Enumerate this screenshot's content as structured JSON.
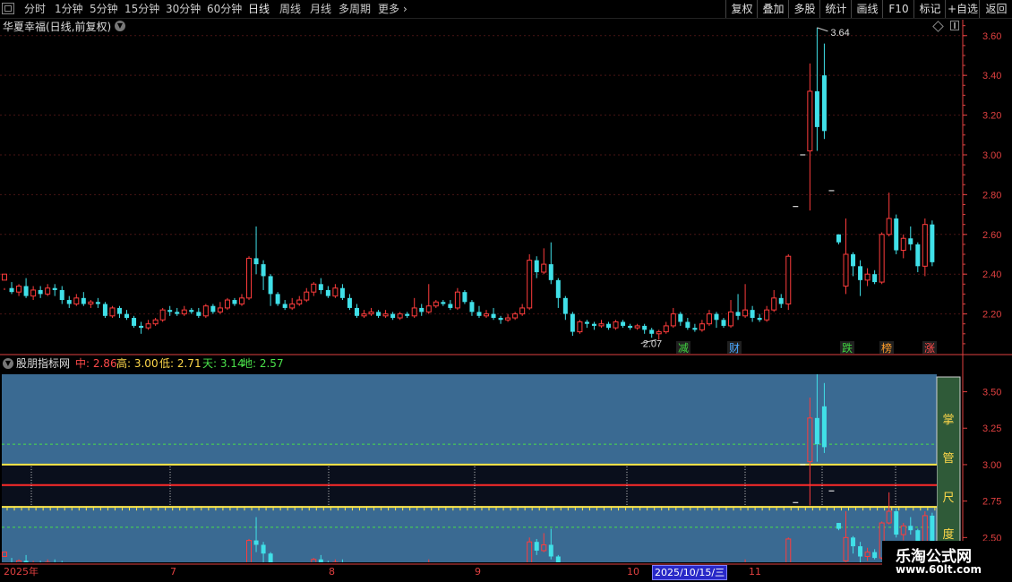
{
  "toolbar": {
    "periods": [
      "分时",
      "1分钟",
      "5分钟",
      "15分钟",
      "30分钟",
      "60分钟",
      "日线",
      "周线",
      "月线",
      "多周期",
      "更多"
    ],
    "active_period": "日线",
    "right_buttons": [
      "复权",
      "叠加",
      "多股",
      "统计",
      "画线",
      "F10",
      "标记",
      "+自选",
      "返回"
    ]
  },
  "main_chart": {
    "title": "华夏幸福(日线,前复权)",
    "high_label": "3.64",
    "low_label": "2.07",
    "axis_labels": [
      "3.60",
      "3.40",
      "3.20",
      "3.00",
      "2.80",
      "2.60",
      "2.40",
      "2.20"
    ],
    "badges": [
      {
        "text": "减",
        "color": "#3fd23f"
      },
      {
        "text": "财",
        "color": "#4aa8ff"
      },
      {
        "text": "跌",
        "color": "#3fd23f"
      },
      {
        "text": "榜",
        "color": "#ff9d2a"
      },
      {
        "text": "涨",
        "color": "#ff4a4a"
      }
    ]
  },
  "indicator": {
    "name": "股朋指标网",
    "values": [
      {
        "label": "中: 2.86",
        "color": "#ff4a4a"
      },
      {
        "label": "高: 3.00",
        "color": "#ffd84a"
      },
      {
        "label": "低: 2.71",
        "color": "#ffd84a"
      },
      {
        "label": "天: 3.14",
        "color": "#4ae04a"
      },
      {
        "label": "地: 2.57",
        "color": "#4ae04a"
      }
    ],
    "axis_labels": [
      "3.50",
      "3.25",
      "3.00",
      "2.75",
      "2.50"
    ],
    "side_labels": [
      "掌",
      "管",
      "尺",
      "度"
    ]
  },
  "date_axis": {
    "labels": [
      "2025年",
      "7",
      "8",
      "9",
      "10",
      "2025/10/15/三",
      "11"
    ]
  },
  "watermark": {
    "title": "乐淘公式网",
    "url": "www.60lt.com"
  },
  "colors": {
    "up": "#ff3c3c",
    "down": "#40e0e8",
    "axis": "#e04040",
    "band": "#3a6a92"
  },
  "chart_data": {
    "type": "candlestick",
    "series_note_visible": false,
    "x_months": [
      "2025年",
      "7",
      "8",
      "9",
      "10",
      "11"
    ],
    "main_ylim": [
      2.0,
      3.68
    ],
    "indicator_ylim": [
      2.33,
      3.62
    ],
    "indicator_lines": {
      "中": 2.86,
      "高": 3.0,
      "低": 2.71,
      "天": 3.14,
      "地": 2.57
    },
    "candles": [
      [
        2.37,
        2.4,
        2.33,
        2.32
      ],
      [
        2.33,
        2.31,
        2.36,
        2.3
      ],
      [
        2.31,
        2.34,
        2.35,
        2.29
      ],
      [
        2.34,
        2.29,
        2.38,
        2.28
      ],
      [
        2.29,
        2.32,
        2.34,
        2.27
      ],
      [
        2.32,
        2.3,
        2.34,
        2.28
      ],
      [
        2.3,
        2.33,
        2.35,
        2.29
      ],
      [
        2.33,
        2.32,
        2.35,
        2.29
      ],
      [
        2.32,
        2.27,
        2.34,
        2.25
      ],
      [
        2.27,
        2.25,
        2.29,
        2.23
      ],
      [
        2.25,
        2.28,
        2.3,
        2.24
      ],
      [
        2.28,
        2.25,
        2.31,
        2.24
      ],
      [
        2.25,
        2.26,
        2.27,
        2.23
      ],
      [
        2.26,
        2.25,
        2.28,
        2.23
      ],
      [
        2.25,
        2.19,
        2.26,
        2.18
      ],
      [
        2.19,
        2.23,
        2.24,
        2.18
      ],
      [
        2.23,
        2.2,
        2.24,
        2.18
      ],
      [
        2.2,
        2.18,
        2.22,
        2.17
      ],
      [
        2.18,
        2.14,
        2.19,
        2.13
      ],
      [
        2.14,
        2.13,
        2.16,
        2.1
      ],
      [
        2.13,
        2.15,
        2.17,
        2.12
      ],
      [
        2.15,
        2.17,
        2.18,
        2.14
      ],
      [
        2.17,
        2.22,
        2.23,
        2.16
      ],
      [
        2.22,
        2.21,
        2.24,
        2.19
      ],
      [
        2.21,
        2.2,
        2.23,
        2.19
      ],
      [
        2.2,
        2.22,
        2.24,
        2.19
      ],
      [
        2.22,
        2.21,
        2.23,
        2.2
      ],
      [
        2.21,
        2.19,
        2.23,
        2.18
      ],
      [
        2.19,
        2.24,
        2.25,
        2.18
      ],
      [
        2.24,
        2.21,
        2.25,
        2.2
      ],
      [
        2.21,
        2.23,
        2.26,
        2.2
      ],
      [
        2.23,
        2.27,
        2.28,
        2.22
      ],
      [
        2.27,
        2.25,
        2.28,
        2.24
      ],
      [
        2.25,
        2.28,
        2.3,
        2.24
      ],
      [
        2.28,
        2.48,
        2.49,
        2.27
      ],
      [
        2.48,
        2.45,
        2.64,
        2.4
      ],
      [
        2.45,
        2.39,
        2.47,
        2.32
      ],
      [
        2.39,
        2.3,
        2.4,
        2.24
      ],
      [
        2.3,
        2.25,
        2.31,
        2.24
      ],
      [
        2.25,
        2.23,
        2.27,
        2.22
      ],
      [
        2.23,
        2.25,
        2.28,
        2.22
      ],
      [
        2.25,
        2.27,
        2.29,
        2.24
      ],
      [
        2.27,
        2.31,
        2.33,
        2.26
      ],
      [
        2.31,
        2.35,
        2.36,
        2.29
      ],
      [
        2.35,
        2.32,
        2.38,
        2.3
      ],
      [
        2.32,
        2.29,
        2.34,
        2.28
      ],
      [
        2.29,
        2.33,
        2.35,
        2.28
      ],
      [
        2.33,
        2.28,
        2.35,
        2.27
      ],
      [
        2.28,
        2.23,
        2.3,
        2.22
      ],
      [
        2.23,
        2.19,
        2.25,
        2.18
      ],
      [
        2.19,
        2.2,
        2.22,
        2.18
      ],
      [
        2.2,
        2.21,
        2.23,
        2.19
      ],
      [
        2.21,
        2.19,
        2.22,
        2.18
      ],
      [
        2.19,
        2.2,
        2.22,
        2.18
      ],
      [
        2.2,
        2.18,
        2.21,
        2.17
      ],
      [
        2.18,
        2.2,
        2.21,
        2.17
      ],
      [
        2.2,
        2.19,
        2.21,
        2.18
      ],
      [
        2.19,
        2.23,
        2.28,
        2.18
      ],
      [
        2.23,
        2.21,
        2.25,
        2.19
      ],
      [
        2.21,
        2.24,
        2.35,
        2.2
      ],
      [
        2.24,
        2.26,
        2.27,
        2.23
      ],
      [
        2.26,
        2.25,
        2.27,
        2.24
      ],
      [
        2.25,
        2.23,
        2.27,
        2.22
      ],
      [
        2.23,
        2.31,
        2.33,
        2.22
      ],
      [
        2.31,
        2.26,
        2.32,
        2.25
      ],
      [
        2.26,
        2.21,
        2.27,
        2.19
      ],
      [
        2.21,
        2.19,
        2.24,
        2.18
      ],
      [
        2.19,
        2.2,
        2.22,
        2.18
      ],
      [
        2.2,
        2.18,
        2.23,
        2.17
      ],
      [
        2.18,
        2.17,
        2.19,
        2.15
      ],
      [
        2.17,
        2.18,
        2.2,
        2.16
      ],
      [
        2.18,
        2.2,
        2.21,
        2.17
      ],
      [
        2.2,
        2.23,
        2.25,
        2.19
      ],
      [
        2.23,
        2.47,
        2.5,
        2.22
      ],
      [
        2.47,
        2.41,
        2.49,
        2.38
      ],
      [
        2.41,
        2.45,
        2.53,
        2.4
      ],
      [
        2.45,
        2.37,
        2.56,
        2.35
      ],
      [
        2.37,
        2.28,
        2.38,
        2.23
      ],
      [
        2.28,
        2.2,
        2.29,
        2.17
      ],
      [
        2.2,
        2.11,
        2.21,
        2.09
      ],
      [
        2.11,
        2.16,
        2.17,
        2.1
      ],
      [
        2.16,
        2.15,
        2.17,
        2.13
      ],
      [
        2.15,
        2.14,
        2.16,
        2.12
      ],
      [
        2.14,
        2.15,
        2.17,
        2.13
      ],
      [
        2.15,
        2.13,
        2.16,
        2.12
      ],
      [
        2.13,
        2.16,
        2.17,
        2.12
      ],
      [
        2.16,
        2.14,
        2.17,
        2.13
      ],
      [
        2.14,
        2.13,
        2.15,
        2.12
      ],
      [
        2.13,
        2.14,
        2.15,
        2.12
      ],
      [
        2.14,
        2.12,
        2.15,
        2.1
      ],
      [
        2.12,
        2.1,
        2.13,
        2.08
      ],
      [
        2.1,
        2.11,
        2.12,
        2.07
      ],
      [
        2.11,
        2.14,
        2.16,
        2.1
      ],
      [
        2.14,
        2.2,
        2.23,
        2.13
      ],
      [
        2.2,
        2.16,
        2.21,
        2.14
      ],
      [
        2.16,
        2.13,
        2.18,
        2.12
      ],
      [
        2.13,
        2.12,
        2.15,
        2.11
      ],
      [
        2.12,
        2.15,
        2.17,
        2.11
      ],
      [
        2.15,
        2.2,
        2.22,
        2.14
      ],
      [
        2.2,
        2.17,
        2.21,
        2.13
      ],
      [
        2.17,
        2.14,
        2.18,
        2.13
      ],
      [
        2.14,
        2.21,
        2.27,
        2.13
      ],
      [
        2.21,
        2.19,
        2.3,
        2.17
      ],
      [
        2.19,
        2.22,
        2.35,
        2.18
      ],
      [
        2.22,
        2.18,
        2.24,
        2.16
      ],
      [
        2.18,
        2.17,
        2.2,
        2.16
      ],
      [
        2.17,
        2.22,
        2.24,
        2.16
      ],
      [
        2.22,
        2.28,
        2.32,
        2.21
      ],
      [
        2.28,
        2.25,
        2.3,
        2.23
      ],
      [
        2.25,
        2.49,
        2.5,
        2.22
      ],
      [
        2.74,
        2.74,
        2.74,
        2.74
      ],
      [
        3.0,
        3.0,
        3.0,
        3.0
      ],
      [
        3.02,
        3.32,
        3.46,
        2.72
      ],
      [
        3.32,
        3.14,
        3.64,
        3.02
      ],
      [
        3.4,
        3.12,
        3.56,
        3.08
      ],
      [
        2.82,
        2.82,
        2.82,
        2.82
      ],
      [
        2.6,
        2.56,
        2.6,
        2.55
      ],
      [
        2.34,
        2.5,
        2.68,
        2.3
      ],
      [
        2.5,
        2.44,
        2.51,
        2.39
      ],
      [
        2.44,
        2.37,
        2.47,
        2.29
      ],
      [
        2.37,
        2.4,
        2.43,
        2.34
      ],
      [
        2.4,
        2.36,
        2.42,
        2.35
      ],
      [
        2.36,
        2.6,
        2.61,
        2.35
      ],
      [
        2.6,
        2.68,
        2.81,
        2.59
      ],
      [
        2.68,
        2.52,
        2.7,
        2.5
      ],
      [
        2.52,
        2.58,
        2.6,
        2.48
      ],
      [
        2.58,
        2.55,
        2.64,
        2.52
      ],
      [
        2.55,
        2.44,
        2.56,
        2.41
      ],
      [
        2.44,
        2.65,
        2.68,
        2.39
      ],
      [
        2.65,
        2.46,
        2.67,
        2.44
      ]
    ]
  }
}
